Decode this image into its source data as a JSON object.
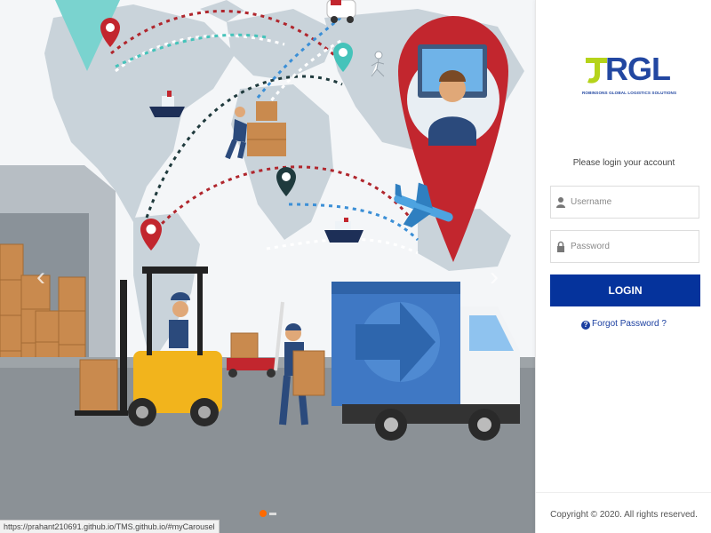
{
  "brand": {
    "logo_text": "RGL",
    "logo_tagline": "ROBINSONS GLOBAL LOGISTICS SOLUTIONS",
    "primary_color": "#05339c",
    "logo_green": "#b5d31a"
  },
  "login": {
    "prompt": "Please login your account",
    "username_placeholder": "Username",
    "password_placeholder": "Password",
    "login_label": "LOGIN",
    "forgot_label": "Forgot Password ?"
  },
  "footer": {
    "copyright": "Copyright © 2020. All rights reserved."
  },
  "carousel": {
    "prev_icon": "chevron-left-icon",
    "next_icon": "chevron-right-icon",
    "indicator_color": "#ff6a00"
  },
  "status_bar": {
    "url": "https://prahant210691.github.io/TMS.github.io/#myCarousel"
  }
}
